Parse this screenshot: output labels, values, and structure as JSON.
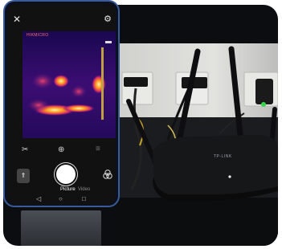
{
  "camera_app": {
    "brand_badge": "HIKMICRO",
    "mode_picture": "Picture",
    "mode_video": "Video",
    "icons": [
      "close-icon",
      "settings-gear-icon",
      "tools-icon",
      "crosshair-icon",
      "menu-icon",
      "gallery-icon",
      "filter-icon",
      "nav-back-icon",
      "nav-home-icon",
      "nav-recents-icon"
    ]
  },
  "scene": {
    "router_brand": "TP-LINK",
    "router_led_color": "#35d64a",
    "wall_color": "#dcdcdc"
  }
}
